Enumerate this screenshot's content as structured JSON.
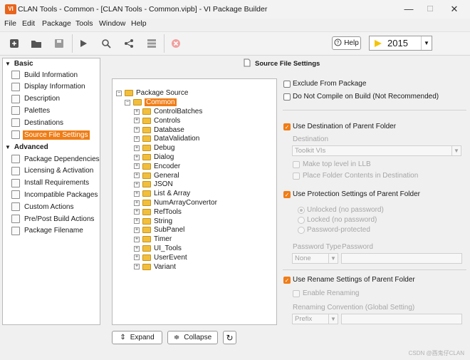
{
  "window": {
    "logo": "VI",
    "title": "CLAN Tools - Common - [CLAN Tools - Common.vipb] - VI Package Builder",
    "minimize": "—",
    "maximize": "☐",
    "close": "✕"
  },
  "menu": [
    "File",
    "Edit",
    "Package",
    "Tools",
    "Window",
    "Help"
  ],
  "toolbar": {
    "icons": [
      "new-icon",
      "open-icon",
      "save-icon",
      "build-icon",
      "find-icon",
      "share-icon",
      "list-icon",
      "stop-icon"
    ],
    "help_label": "Help",
    "version": "2015"
  },
  "sidebar": {
    "basic_label": "Basic",
    "basic_items": [
      {
        "label": "Build Information"
      },
      {
        "label": "Display Information"
      },
      {
        "label": "Description"
      },
      {
        "label": "Palettes"
      },
      {
        "label": "Destinations"
      },
      {
        "label": "Source File Settings",
        "selected": true
      }
    ],
    "advanced_label": "Advanced",
    "advanced_items": [
      {
        "label": "Package Dependencies"
      },
      {
        "label": "Licensing & Activation"
      },
      {
        "label": "Install Requirements"
      },
      {
        "label": "Incompatible Packages"
      },
      {
        "label": "Custom Actions"
      },
      {
        "label": "Pre/Post Build Actions"
      },
      {
        "label": "Package Filename"
      }
    ]
  },
  "main": {
    "heading": "Source File Settings"
  },
  "tree": {
    "root": "Package Source",
    "selected": "Common",
    "children": [
      "ControlBatches",
      "Controls",
      "Database",
      "DataValidation",
      "Debug",
      "Dialog",
      "Encoder",
      "General",
      "JSON",
      "List & Array",
      "NumArrayConvertor",
      "RefTools",
      "String",
      "SubPanel",
      "Timer",
      "UI_Tools",
      "UserEvent",
      "Variant"
    ]
  },
  "buttons": {
    "expand": "Expand",
    "collapse": "Collapse"
  },
  "settings": {
    "exclude": "Exclude From Package",
    "no_compile": "Do Not Compile on Build (Not Recommended)",
    "use_dest": "Use Destination of Parent Folder",
    "destination_label": "Destination",
    "destination_value": "Toolkit VIs",
    "make_top": "Make top level in LLB",
    "place_folder": "Place Folder Contents in Destination",
    "use_protect": "Use Protection Settings of Parent Folder",
    "unlocked": "Unlocked (no password)",
    "locked": "Locked (no password)",
    "protected": "Password-protected",
    "password_type_label": "Password Type",
    "password_label": "Password",
    "password_type_value": "None",
    "use_rename": "Use Rename Settings of Parent Folder",
    "enable_renaming": "Enable Renaming",
    "rename_convention": "Renaming Convention (Global Setting)",
    "prefix_value": "Prefix"
  },
  "watermark": "CSDN @酉鬼仔CLAN"
}
